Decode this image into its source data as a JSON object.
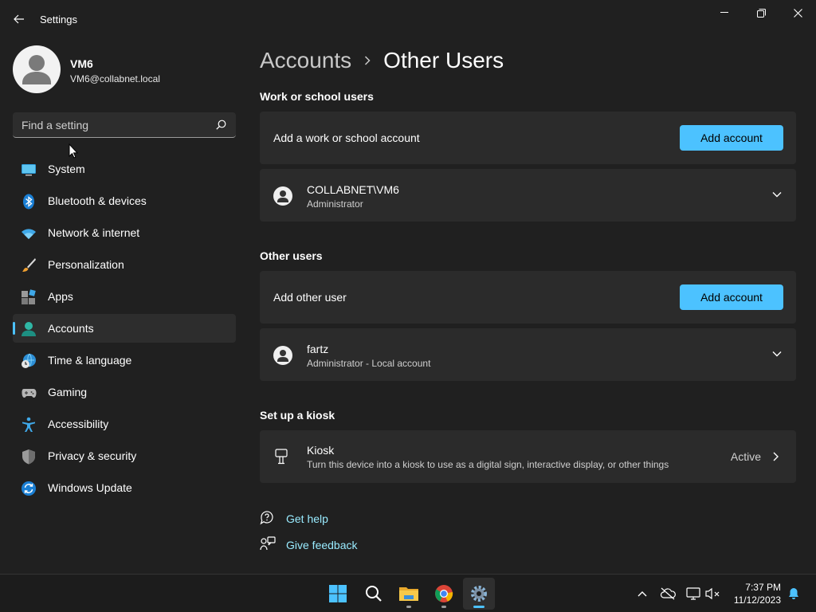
{
  "window": {
    "title": "Settings"
  },
  "profile": {
    "name": "VM6",
    "email": "VM6@collabnet.local"
  },
  "search": {
    "placeholder": "Find a setting"
  },
  "sidebar": {
    "items": [
      {
        "label": "System",
        "icon": "system-icon"
      },
      {
        "label": "Bluetooth & devices",
        "icon": "bluetooth-icon"
      },
      {
        "label": "Network & internet",
        "icon": "wifi-icon"
      },
      {
        "label": "Personalization",
        "icon": "brush-icon"
      },
      {
        "label": "Apps",
        "icon": "apps-icon"
      },
      {
        "label": "Accounts",
        "icon": "account-icon",
        "selected": true
      },
      {
        "label": "Time & language",
        "icon": "clock-globe-icon"
      },
      {
        "label": "Gaming",
        "icon": "gamepad-icon"
      },
      {
        "label": "Accessibility",
        "icon": "accessibility-icon"
      },
      {
        "label": "Privacy & security",
        "icon": "shield-icon"
      },
      {
        "label": "Windows Update",
        "icon": "update-icon"
      }
    ]
  },
  "breadcrumb": {
    "parent": "Accounts",
    "current": "Other Users"
  },
  "work_section": {
    "title": "Work or school users",
    "add_label": "Add a work or school account",
    "add_button": "Add account",
    "user": {
      "name": "COLLABNET\\VM6",
      "role": "Administrator"
    }
  },
  "other_section": {
    "title": "Other users",
    "add_label": "Add other user",
    "add_button": "Add account",
    "user": {
      "name": "fartz",
      "role": "Administrator - Local account"
    }
  },
  "kiosk_section": {
    "title": "Set up a kiosk",
    "name": "Kiosk",
    "description": "Turn this device into a kiosk to use as a digital sign, interactive display, or other things",
    "status": "Active"
  },
  "help": {
    "get_help": "Get help",
    "give_feedback": "Give feedback"
  },
  "taskbar": {
    "time": "7:37 PM",
    "date": "11/12/2023"
  },
  "colors": {
    "accent": "#4cc2ff",
    "background": "#202020",
    "card": "#2b2b2b",
    "link": "#99ebff"
  }
}
